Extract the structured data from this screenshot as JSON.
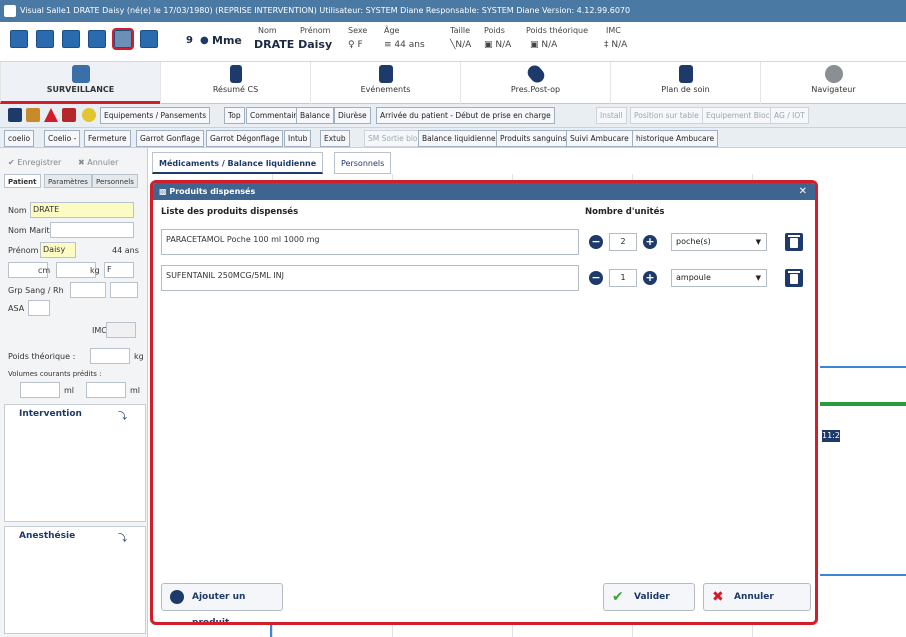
{
  "titlebar": {
    "text": "Visual  Salle1  DRATE Daisy (né(e) le 17/03/1980)  (REPRISE INTERVENTION)  Utilisateur: SYSTEM Diane  Responsable: SYSTEM Diane  Version: 4.12.99.6070"
  },
  "patient_header": {
    "count": "9",
    "civility": "Mme",
    "nom_label": "Nom",
    "prenom_label": "Prénom",
    "name": "DRATE Daisy",
    "sexe_label": "Sexe",
    "sexe_value": "F",
    "age_label": "Âge",
    "age_value": "44 ans",
    "taille_label": "Taille",
    "taille_value": "N/A",
    "poids_label": "Poids",
    "poids_value": "N/A",
    "poids_theo_label": "Poids théorique",
    "poids_theo_value": "N/A",
    "imc_label": "IMC",
    "imc_value": "N/A"
  },
  "nav": [
    {
      "label": "SURVEILLANCE"
    },
    {
      "label": "Résumé CS"
    },
    {
      "label": "Evénements"
    },
    {
      "label": "Pres.Post-op"
    },
    {
      "label": "Plan de soin"
    },
    {
      "label": "Navigateur"
    }
  ],
  "actions1": [
    "Equipements / Pansements",
    "Top",
    "Commentaire",
    "Balance",
    "Diurèse",
    "Arrivée du patient - Début de prise en charge",
    "Install",
    "Position sur table",
    "Equipement Bloc",
    "AG / IOT"
  ],
  "actions2": [
    "coelio",
    "Coelio -",
    "Fermeture",
    "Garrot Gonflage",
    "Garrot Dégonflage",
    "Intub",
    "Extub",
    "SM Sortie bloc",
    "Balance liquidienne",
    "Produits sanguins",
    "Suivi Ambucare",
    "historique Ambucare"
  ],
  "left": {
    "save": "Enregistrer",
    "cancel": "Annuler",
    "tabs": [
      "Patient",
      "Paramètres",
      "Personnels"
    ],
    "nom_label": "Nom",
    "nom_value": "DRATE",
    "nom_marit_label": "Nom Marit.",
    "prenom_label": "Prénom",
    "prenom_value": "Daisy",
    "age_value": "44 ans",
    "cm_label": "cm",
    "kg_label": "kg",
    "sexe_value": "F",
    "grp_label": "Grp Sang / Rh",
    "asa_label": "ASA",
    "imc_label": "IMC",
    "poids_theo_label": "Poids théorique :",
    "kg2": "kg",
    "vol_label": "Volumes courants prédits :",
    "ml1": "ml",
    "ml2": "ml",
    "section1": "Intervention",
    "section2": "Anesthésie"
  },
  "main_tabs": [
    "Médicaments / Balance liquidienne",
    "Personnels"
  ],
  "timeline": {
    "time": "11:20"
  },
  "modal": {
    "title": "Produits dispensés",
    "col_list": "Liste des produits dispensés",
    "col_units": "Nombre d'unités",
    "products": [
      {
        "name": "PARACETAMOL Poche 100 ml 1000 mg",
        "qty": "2",
        "unit": "poche(s)"
      },
      {
        "name": "SUFENTANIL 250MCG/5ML INJ",
        "qty": "1",
        "unit": "ampoule"
      }
    ],
    "add_label": "Ajouter un produit",
    "ok_label": "Valider",
    "cancel_label": "Annuler"
  }
}
